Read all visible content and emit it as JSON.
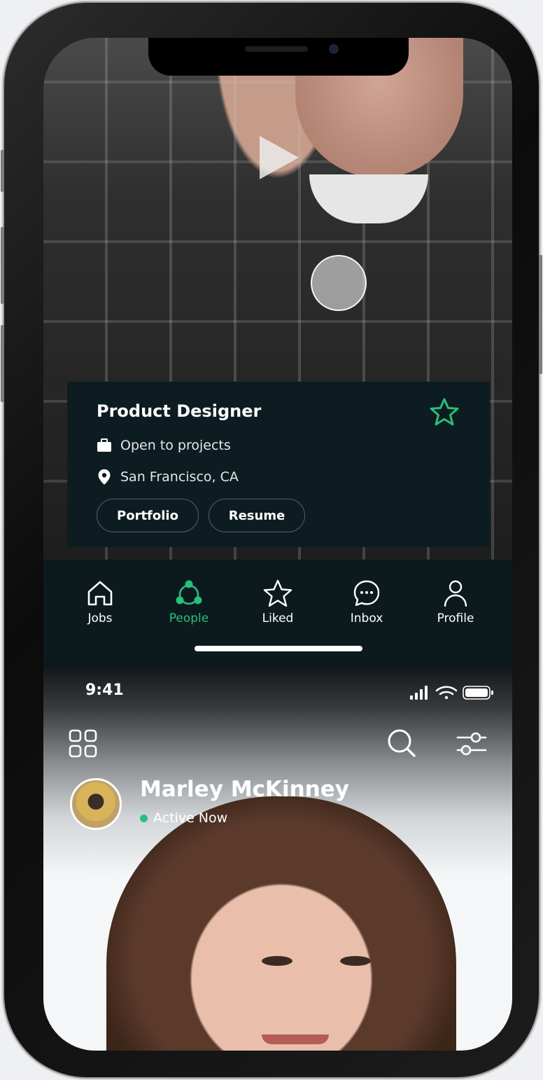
{
  "profile_card": {
    "title": "Product Designer",
    "availability": "Open to projects",
    "location": "San Francisco, CA",
    "buttons": {
      "portfolio": "Portfolio",
      "resume": "Resume"
    }
  },
  "tab_bar": {
    "items": [
      {
        "label": "Jobs",
        "icon": "home-icon"
      },
      {
        "label": "People",
        "icon": "people-network-icon",
        "active": true
      },
      {
        "label": "Liked",
        "icon": "star-icon"
      },
      {
        "label": "Inbox",
        "icon": "chat-bubble-icon"
      },
      {
        "label": "Profile",
        "icon": "user-icon"
      }
    ]
  },
  "status_bar": {
    "time": "9:41"
  },
  "person": {
    "name": "Marley McKinney",
    "status": "Active Now"
  },
  "colors": {
    "accent": "#27c07a",
    "card_bg": "#0d1c21",
    "tabbar_bg": "#0c1a1e"
  }
}
